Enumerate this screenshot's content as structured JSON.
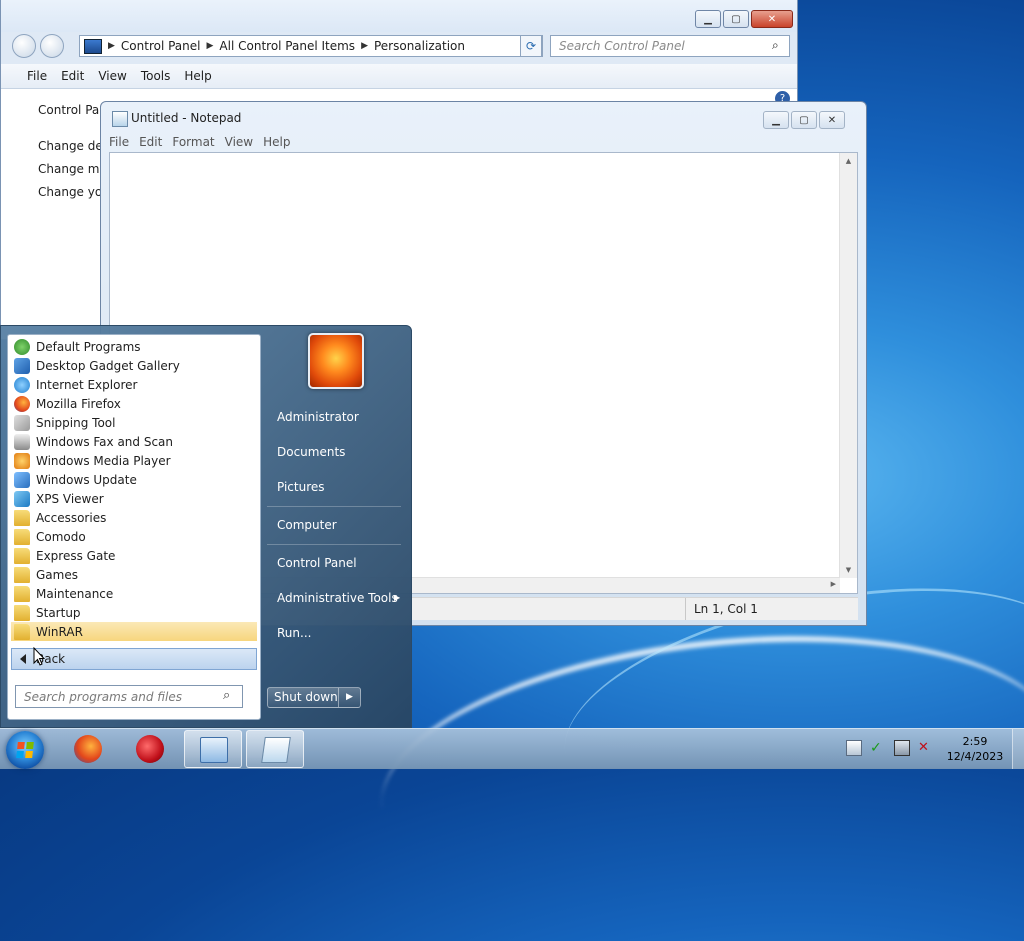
{
  "control_panel": {
    "breadcrumb": [
      "Control Panel",
      "All Control Panel Items",
      "Personalization"
    ],
    "search_placeholder": "Search Control Panel",
    "menu": [
      "File",
      "Edit",
      "View",
      "Tools",
      "Help"
    ],
    "content_links": [
      "Control Panel",
      "Change des",
      "Change mo",
      "Change you"
    ]
  },
  "notepad": {
    "title": "Untitled - Notepad",
    "menu": [
      "File",
      "Edit",
      "Format",
      "View",
      "Help"
    ],
    "status": "Ln 1, Col 1"
  },
  "start_menu": {
    "programs": [
      {
        "label": "Default Programs",
        "icon": "default-programs-icon"
      },
      {
        "label": "Desktop Gadget Gallery",
        "icon": "gadget-icon"
      },
      {
        "label": "Internet Explorer",
        "icon": "ie-icon"
      },
      {
        "label": "Mozilla Firefox",
        "icon": "firefox-icon"
      },
      {
        "label": "Snipping Tool",
        "icon": "scissors-icon"
      },
      {
        "label": "Windows Fax and Scan",
        "icon": "fax-icon"
      },
      {
        "label": "Windows Media Player",
        "icon": "media-player-icon"
      },
      {
        "label": "Windows Update",
        "icon": "update-icon"
      },
      {
        "label": "XPS Viewer",
        "icon": "xps-icon"
      },
      {
        "label": "Accessories",
        "icon": "folder-icon"
      },
      {
        "label": "Comodo",
        "icon": "folder-icon"
      },
      {
        "label": "Express Gate",
        "icon": "folder-icon"
      },
      {
        "label": "Games",
        "icon": "folder-icon"
      },
      {
        "label": "Maintenance",
        "icon": "folder-icon"
      },
      {
        "label": "Startup",
        "icon": "folder-icon"
      },
      {
        "label": "WinRAR",
        "icon": "folder-icon"
      }
    ],
    "back_label": "Back",
    "search_placeholder": "Search programs and files",
    "right_items": [
      "Administrator",
      "Documents",
      "Pictures",
      "Computer",
      "Control Panel",
      "Administrative Tools",
      "Run..."
    ],
    "shutdown_label": "Shut down"
  },
  "taskbar": {
    "time": "2:59",
    "date": "12/4/2023"
  },
  "colors": {
    "accent": "#1564bd",
    "selection": "#f7d67d"
  }
}
